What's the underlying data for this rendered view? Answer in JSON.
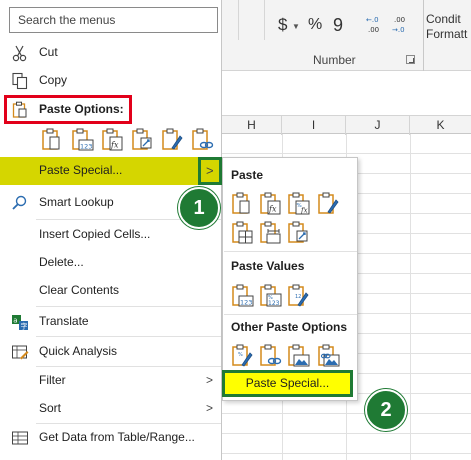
{
  "ribbon": {
    "currency_symbol": "$",
    "percent_symbol": "%",
    "comma_symbol": "9",
    "inc_decimal_label": "←.0\n.00",
    "dec_decimal_label": ".00\n→.0",
    "number_group_label": "Number",
    "conditional_label": "Condit\nFormatt"
  },
  "sheet": {
    "columns": [
      "H",
      "I",
      "J",
      "K"
    ]
  },
  "menu": {
    "search_placeholder": "Search the menus",
    "cut": "Cut",
    "copy": "Copy",
    "paste_options": "Paste Options:",
    "paste_special": "Paste Special...",
    "smart_lookup": "Smart Lookup",
    "insert_copied_cells": "Insert Copied Cells...",
    "delete": "Delete...",
    "clear_contents": "Clear Contents",
    "translate": "Translate",
    "quick_analysis": "Quick Analysis",
    "filter": "Filter",
    "sort": "Sort",
    "get_data": "Get Data from Table/Range..."
  },
  "submenu": {
    "paste_heading": "Paste",
    "paste_values_heading": "Paste Values",
    "other_paste_heading": "Other Paste Options",
    "paste_special_button": "Paste Special..."
  },
  "badges": {
    "step1": "1",
    "step2": "2"
  },
  "colors": {
    "highlight": "#d5d600",
    "button_yellow": "#ffff00",
    "badge_green": "#1f7a34",
    "frame_red": "#e2001a",
    "icon_orange": "#d48a1c",
    "icon_blue": "#2b6cb0"
  }
}
